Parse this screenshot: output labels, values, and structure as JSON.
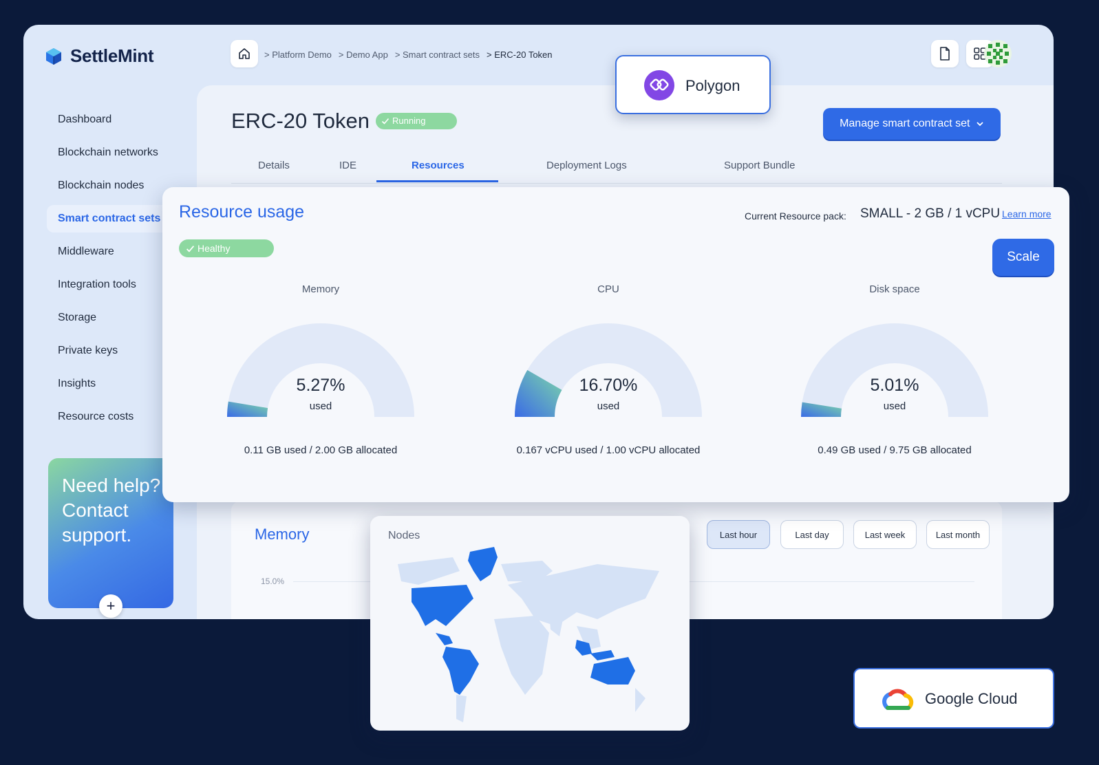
{
  "app": {
    "logo_text": "SettleMint"
  },
  "breadcrumb": {
    "items": [
      "> Platform Demo",
      "> Demo App",
      "> Smart contract sets",
      "> ERC-20 Token"
    ]
  },
  "sidebar": {
    "items": [
      {
        "label": "Dashboard"
      },
      {
        "label": "Blockchain networks"
      },
      {
        "label": "Blockchain nodes"
      },
      {
        "label": "Smart contract sets",
        "active": true
      },
      {
        "label": "Middleware"
      },
      {
        "label": "Integration tools"
      },
      {
        "label": "Storage"
      },
      {
        "label": "Private keys"
      },
      {
        "label": "Insights"
      },
      {
        "label": "Resource costs"
      }
    ],
    "help_text": "Need help? Contact support.",
    "help_plus": "+"
  },
  "page": {
    "title": "ERC-20 Token",
    "status": "Running",
    "manage_button": "Manage smart contract set",
    "tabs": [
      "Details",
      "IDE",
      "Resources",
      "Deployment Logs",
      "Support Bundle"
    ],
    "active_tab": "Resources"
  },
  "resource_usage": {
    "title": "Resource usage",
    "pack_label": "Current Resource pack:",
    "pack_value": "SMALL -  2 GB / 1 vCPU",
    "learn_more": "Learn more",
    "health": "Healthy",
    "scale_button": "Scale",
    "gauges": [
      {
        "label": "Memory",
        "percent": 5.27,
        "percent_text": "5.27%",
        "used_text": "used",
        "alloc_text": "0.11 GB used / 2.00 GB allocated"
      },
      {
        "label": "CPU",
        "percent": 16.7,
        "percent_text": "16.70%",
        "used_text": "used",
        "alloc_text": "0.167 vCPU used / 1.00 vCPU allocated"
      },
      {
        "label": "Disk space",
        "percent": 5.01,
        "percent_text": "5.01%",
        "used_text": "used",
        "alloc_text": "0.49 GB used / 9.75 GB allocated"
      }
    ]
  },
  "memory_chart": {
    "title": "Memory",
    "ytick": "15.0%",
    "ranges": [
      "Last hour",
      "Last day",
      "Last week",
      "Last month"
    ],
    "active_range": "Last hour"
  },
  "nodes": {
    "title": "Nodes"
  },
  "integrations": {
    "polygon": "Polygon",
    "google_cloud": "Google Cloud"
  },
  "colors": {
    "accent": "#2f6ae6",
    "status_green": "#8dd8a0",
    "map_highlight": "#1f6fe6",
    "map_base": "#d5e2f6"
  },
  "icons": [
    "home-icon",
    "document-icon",
    "grid-icon",
    "check-icon",
    "chevron-down-icon",
    "plus-icon"
  ]
}
